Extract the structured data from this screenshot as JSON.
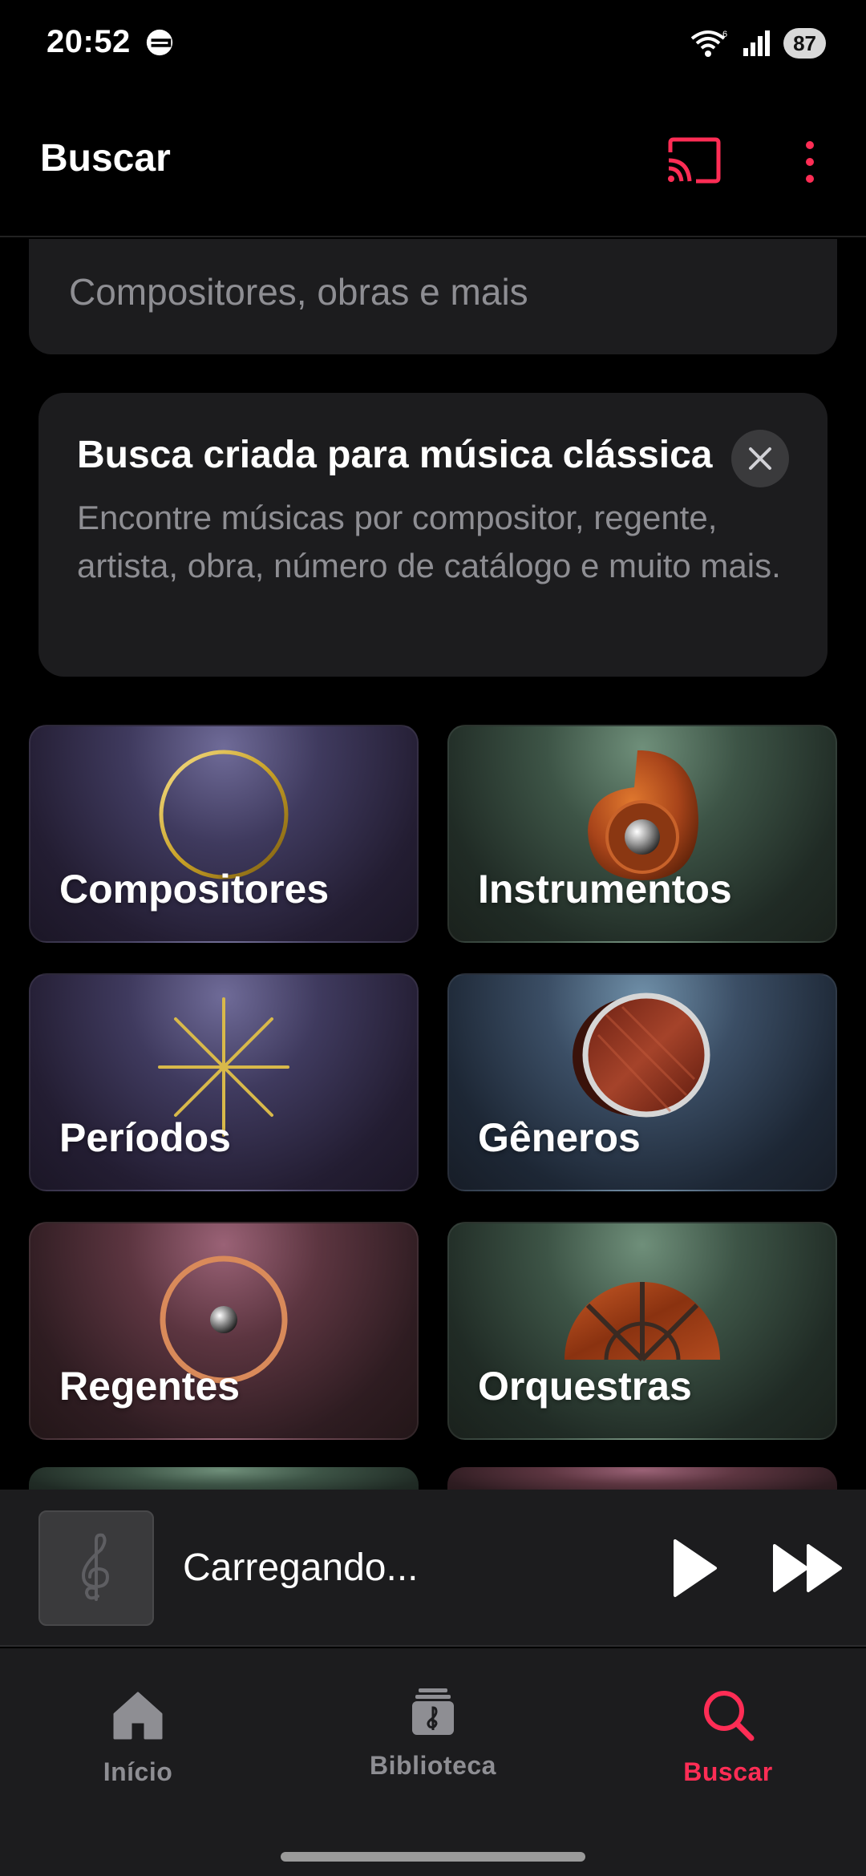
{
  "status_bar": {
    "time": "20:52",
    "battery": "87",
    "icons": [
      "wifi-icon",
      "signal-icon",
      "battery-icon"
    ]
  },
  "header": {
    "title": "Buscar",
    "accent_color": "#ff2d55"
  },
  "search": {
    "placeholder": "Compositores, obras e mais",
    "value": ""
  },
  "info_card": {
    "title": "Busca criada para música clássica",
    "body": "Encontre músicas por compositor, regente, artista, obra, número de catálogo e muito mais."
  },
  "categories": [
    {
      "label": "Compositores",
      "icon": "gold-ring-icon"
    },
    {
      "label": "Instrumentos",
      "icon": "spiral-shell-icon"
    },
    {
      "label": "Períodos",
      "icon": "star-burst-icon"
    },
    {
      "label": "Gêneros",
      "icon": "wood-disc-icon"
    },
    {
      "label": "Regentes",
      "icon": "copper-ring-icon"
    },
    {
      "label": "Orquestras",
      "icon": "fan-window-icon"
    }
  ],
  "mini_player": {
    "title": "Carregando...",
    "art_icon": "treble-clef-icon"
  },
  "bottom_nav": {
    "items": [
      {
        "label": "Início",
        "icon": "home-icon",
        "active": false
      },
      {
        "label": "Biblioteca",
        "icon": "library-icon",
        "active": false
      },
      {
        "label": "Buscar",
        "icon": "search-icon",
        "active": true
      }
    ]
  }
}
